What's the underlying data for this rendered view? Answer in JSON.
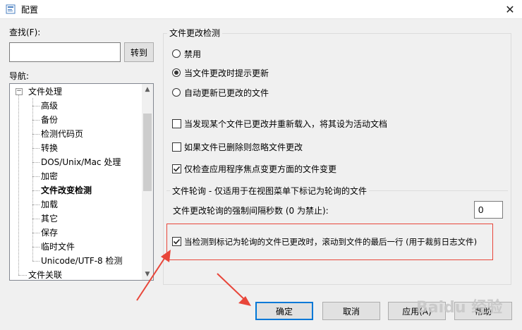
{
  "window": {
    "title": "配置",
    "close_glyph": "✕"
  },
  "search": {
    "label": "查找(F):",
    "value": "",
    "go_button": "转到"
  },
  "nav": {
    "label": "导航:",
    "items": [
      {
        "label": "文件处理"
      },
      {
        "label": "高级"
      },
      {
        "label": "备份"
      },
      {
        "label": "检测代码页"
      },
      {
        "label": "转换"
      },
      {
        "label": "DOS/Unix/Mac 处理"
      },
      {
        "label": "加密"
      },
      {
        "label": "文件改变检测"
      },
      {
        "label": "加载"
      },
      {
        "label": "其它"
      },
      {
        "label": "保存"
      },
      {
        "label": "临时文件"
      },
      {
        "label": "Unicode/UTF-8 检测"
      },
      {
        "label": "文件关联"
      }
    ],
    "expander_glyph": "−",
    "scroll_up": "▲",
    "scroll_down": "▼"
  },
  "file_change": {
    "legend": "文件更改检测",
    "options": [
      {
        "label": "禁用",
        "selected": false
      },
      {
        "label": "当文件更改时提示更新",
        "selected": true
      },
      {
        "label": "自动更新已更改的文件",
        "selected": false
      }
    ],
    "checks": [
      {
        "label": "当发现某个文件已更改并重新载入，将其设为活动文档",
        "checked": false
      },
      {
        "label": "如果文件已删除则忽略文件更改",
        "checked": false
      },
      {
        "label": "仅检查应用程序焦点变更方面的文件变更",
        "checked": true
      }
    ]
  },
  "polling": {
    "legend": "文件轮询 - 仅适用于在视图菜单下标记为轮询的文件",
    "interval_label": "文件更改轮询的强制间隔秒数 (0 为禁止):",
    "interval_value": "0",
    "scroll_check": {
      "label": "当检测到标记为轮询的文件已更改时，滚动到文件的最后一行 (用于裁剪日志文件)",
      "checked": true
    }
  },
  "buttons": {
    "ok": "确定",
    "cancel": "取消",
    "apply": "应用(A)",
    "help": "帮助"
  },
  "watermark": {
    "text": "Baidu 经验"
  },
  "colors": {
    "accent": "#0078d7",
    "annotation": "#e8463a"
  }
}
